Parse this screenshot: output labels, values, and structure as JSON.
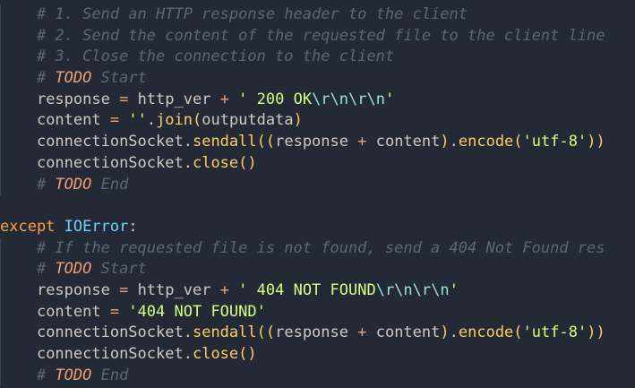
{
  "editor": {
    "colors": {
      "background": "#242936",
      "comment": "#5c6773",
      "keyword": "#ff9f43",
      "function": "#ffcc66",
      "string": "#d5ff80",
      "operator": "#f29e74",
      "class": "#73d0ff",
      "text": "#cccac2"
    },
    "lines": [
      {
        "indent": "    ",
        "tokens": [
          {
            "t": "# 1. Send an HTTP response header to the client",
            "c": "comment"
          }
        ]
      },
      {
        "indent": "    ",
        "tokens": [
          {
            "t": "# 2. Send the content of the requested file to the client line",
            "c": "comment"
          }
        ]
      },
      {
        "indent": "    ",
        "tokens": [
          {
            "t": "# 3. Close the connection to the client",
            "c": "comment"
          }
        ]
      },
      {
        "indent": "    ",
        "tokens": [
          {
            "t": "# ",
            "c": "comment"
          },
          {
            "t": "TODO",
            "c": "todo"
          },
          {
            "t": " Start",
            "c": "comment"
          }
        ]
      },
      {
        "indent": "    ",
        "tokens": [
          {
            "t": "response ",
            "c": "punc"
          },
          {
            "t": "=",
            "c": "op"
          },
          {
            "t": " http_ver ",
            "c": "punc"
          },
          {
            "t": "+",
            "c": "op"
          },
          {
            "t": " ' 200 OK",
            "c": "str"
          },
          {
            "t": "\\r\\n\\r\\n",
            "c": "esc"
          },
          {
            "t": "'",
            "c": "str"
          }
        ]
      },
      {
        "indent": "    ",
        "tokens": [
          {
            "t": "content ",
            "c": "punc"
          },
          {
            "t": "=",
            "c": "op"
          },
          {
            "t": " ''",
            "c": "str"
          },
          {
            "t": ".",
            "c": "punc"
          },
          {
            "t": "join",
            "c": "fn"
          },
          {
            "t": "(",
            "c": "fn"
          },
          {
            "t": "outputdata",
            "c": "punc"
          },
          {
            "t": ")",
            "c": "fn"
          }
        ]
      },
      {
        "indent": "    ",
        "tokens": [
          {
            "t": "connectionSocket",
            "c": "punc"
          },
          {
            "t": ".",
            "c": "punc"
          },
          {
            "t": "sendall",
            "c": "fn"
          },
          {
            "t": "((",
            "c": "fn"
          },
          {
            "t": "response ",
            "c": "punc"
          },
          {
            "t": "+",
            "c": "op"
          },
          {
            "t": " content",
            "c": "punc"
          },
          {
            "t": ")",
            "c": "fn"
          },
          {
            "t": ".",
            "c": "punc"
          },
          {
            "t": "encode",
            "c": "fn"
          },
          {
            "t": "(",
            "c": "fn"
          },
          {
            "t": "'utf-8'",
            "c": "str"
          },
          {
            "t": "))",
            "c": "fn"
          }
        ]
      },
      {
        "indent": "    ",
        "tokens": [
          {
            "t": "connectionSocket",
            "c": "punc"
          },
          {
            "t": ".",
            "c": "punc"
          },
          {
            "t": "close",
            "c": "fn"
          },
          {
            "t": "()",
            "c": "fn"
          }
        ]
      },
      {
        "indent": "    ",
        "tokens": [
          {
            "t": "# ",
            "c": "comment"
          },
          {
            "t": "TODO",
            "c": "todo"
          },
          {
            "t": " End",
            "c": "comment"
          }
        ]
      },
      {
        "indent": "",
        "tokens": []
      },
      {
        "indent": "",
        "tokens": [
          {
            "t": "except",
            "c": "kw"
          },
          {
            "t": " ",
            "c": "punc"
          },
          {
            "t": "IOError",
            "c": "cls"
          },
          {
            "t": ":",
            "c": "punc"
          }
        ]
      },
      {
        "indent": "    ",
        "tokens": [
          {
            "t": "# If the requested file is not found, send a 404 Not Found res",
            "c": "comment"
          }
        ]
      },
      {
        "indent": "    ",
        "tokens": [
          {
            "t": "# ",
            "c": "comment"
          },
          {
            "t": "TODO",
            "c": "todo"
          },
          {
            "t": " Start",
            "c": "comment"
          }
        ]
      },
      {
        "indent": "    ",
        "tokens": [
          {
            "t": "response ",
            "c": "punc"
          },
          {
            "t": "=",
            "c": "op"
          },
          {
            "t": " http_ver ",
            "c": "punc"
          },
          {
            "t": "+",
            "c": "op"
          },
          {
            "t": " ' 404 NOT FOUND",
            "c": "str"
          },
          {
            "t": "\\r\\n\\r\\n",
            "c": "esc"
          },
          {
            "t": "'",
            "c": "str"
          }
        ]
      },
      {
        "indent": "    ",
        "tokens": [
          {
            "t": "content ",
            "c": "punc"
          },
          {
            "t": "=",
            "c": "op"
          },
          {
            "t": " '404 NOT FOUND'",
            "c": "str"
          }
        ]
      },
      {
        "indent": "    ",
        "tokens": [
          {
            "t": "connectionSocket",
            "c": "punc"
          },
          {
            "t": ".",
            "c": "punc"
          },
          {
            "t": "sendall",
            "c": "fn"
          },
          {
            "t": "((",
            "c": "fn"
          },
          {
            "t": "response ",
            "c": "punc"
          },
          {
            "t": "+",
            "c": "op"
          },
          {
            "t": " content",
            "c": "punc"
          },
          {
            "t": ")",
            "c": "fn"
          },
          {
            "t": ".",
            "c": "punc"
          },
          {
            "t": "encode",
            "c": "fn"
          },
          {
            "t": "(",
            "c": "fn"
          },
          {
            "t": "'utf-8'",
            "c": "str"
          },
          {
            "t": "))",
            "c": "fn"
          }
        ]
      },
      {
        "indent": "    ",
        "tokens": [
          {
            "t": "connectionSocket",
            "c": "punc"
          },
          {
            "t": ".",
            "c": "punc"
          },
          {
            "t": "close",
            "c": "fn"
          },
          {
            "t": "()",
            "c": "fn"
          }
        ]
      },
      {
        "indent": "    ",
        "tokens": [
          {
            "t": "# ",
            "c": "comment"
          },
          {
            "t": "TODO",
            "c": "todo"
          },
          {
            "t": " End",
            "c": "comment"
          }
        ]
      }
    ]
  }
}
